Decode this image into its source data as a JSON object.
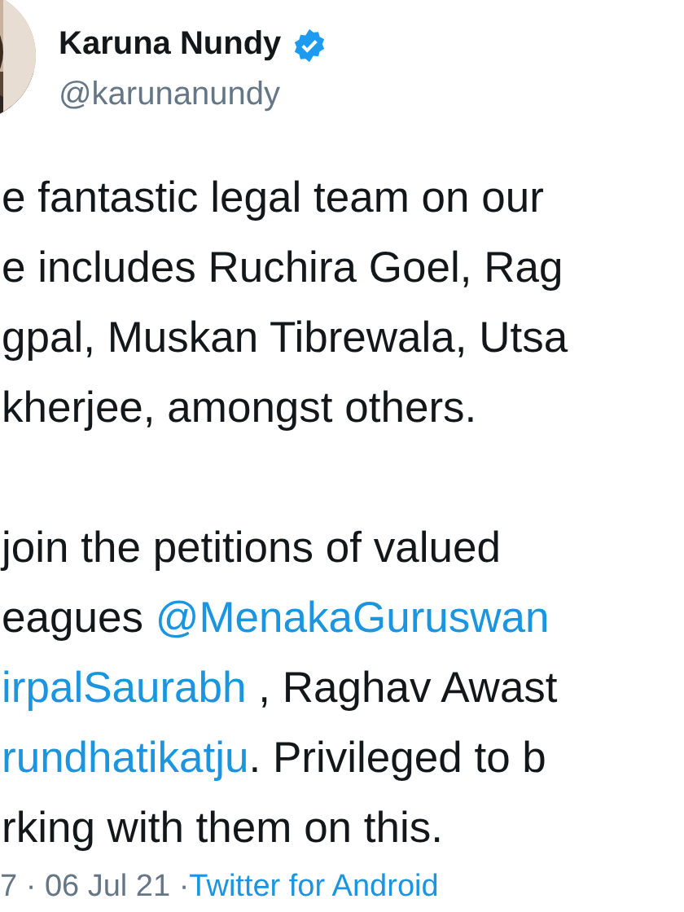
{
  "author": {
    "name": "Karuna Nundy",
    "verified": true,
    "handle": "@karunanundy"
  },
  "paragraphs": [
    {
      "lines": [
        [
          {
            "kind": "text",
            "text": "e fantastic legal team on our"
          }
        ],
        [
          {
            "kind": "text",
            "text": "e includes Ruchira Goel, Rag"
          }
        ],
        [
          {
            "kind": "text",
            "text": "gpal, Muskan Tibrewala, Utsa"
          }
        ],
        [
          {
            "kind": "text",
            "text": "kherjee, amongst others."
          }
        ]
      ]
    },
    {
      "lines": [
        [
          {
            "kind": "text",
            "text": "join the petitions of valued"
          }
        ],
        [
          {
            "kind": "text",
            "text": "eagues "
          },
          {
            "kind": "mention",
            "text": "@MenakaGuruswan"
          }
        ],
        [
          {
            "kind": "mention",
            "text": "irpalSaurabh"
          },
          {
            "kind": "text",
            "text": " , Raghav Awast"
          }
        ],
        [
          {
            "kind": "mention",
            "text": "rundhatikatju"
          },
          {
            "kind": "text",
            "text": ". Privileged to b"
          }
        ],
        [
          {
            "kind": "text",
            "text": "rking with them on this."
          }
        ]
      ]
    }
  ],
  "footer": {
    "meta": "7 · 06 Jul 21 · ",
    "source": "Twitter for Android"
  }
}
